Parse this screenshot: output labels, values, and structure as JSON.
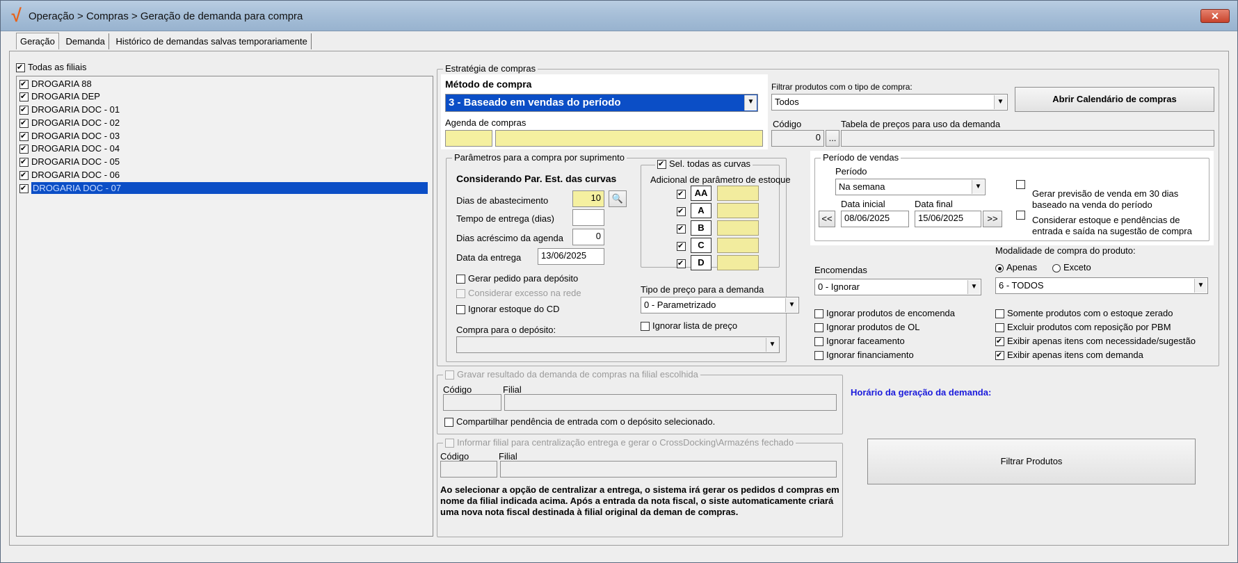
{
  "window": {
    "title": "Operação > Compras > Geração de demanda para compra",
    "close_icon": "close-icon"
  },
  "tabs": [
    "Geração",
    "Demanda",
    "Histórico de demandas salvas temporariamente"
  ],
  "branches": {
    "all_label": "Todas as filiais",
    "items": [
      "DROGARIA 88",
      "DROGARIA DEP",
      "DROGARIA DOC - 01",
      "DROGARIA DOC - 02",
      "DROGARIA DOC - 03",
      "DROGARIA DOC - 04",
      "DROGARIA DOC - 05",
      "DROGARIA DOC - 06",
      "DROGARIA DOC - 07"
    ]
  },
  "strategy": {
    "legend": "Estratégia de compras",
    "method_label": "Método de compra",
    "method_value": "3 - Baseado em vendas do período",
    "agenda_label": "Agenda de compras",
    "filter_type_label": "Filtrar produtos com o tipo de compra:",
    "filter_type_value": "Todos",
    "calendar_button": "Abrir Calendário de compras",
    "code_label": "Código",
    "code_value": "0",
    "code_btn": "...",
    "price_table_label": "Tabela de preços para uso da demanda"
  },
  "params": {
    "legend": "Parâmetros para a compra por suprimento",
    "heading": "Considerando Par. Est. das curvas",
    "supply_days_label": "Dias de abastecimento",
    "supply_days_value": "10",
    "delivery_time_label": "Tempo de entrega (dias)",
    "agenda_days_label": "Dias acréscimo da agenda",
    "agenda_days_value": "0",
    "delivery_date_label": "Data da entrega",
    "delivery_date_value": "13/06/2025",
    "gen_order_label": "Gerar pedido para depósito",
    "excess_label": "Considerar excesso na rede",
    "ignore_cd_label": "Ignorar estoque do CD",
    "deposit_label": "Compra para o depósito:",
    "curves_legend": "Sel. todas as curvas",
    "curves_sub": "Adicional de parâmetro de estoque",
    "curves": [
      "AA",
      "A",
      "B",
      "C",
      "D"
    ],
    "price_type_label": "Tipo de preço para a demanda",
    "price_type_value": "0 - Parametrizado",
    "ignore_price_list_label": "Ignorar lista de preço"
  },
  "sales_period": {
    "legend": "Período de vendas",
    "period_label": "Período",
    "period_value": "Na semana",
    "start_label": "Data inicial",
    "start_value": "08/06/2025",
    "end_label": "Data final",
    "end_value": "15/06/2025",
    "prev_btn": "<<",
    "next_btn": ">>",
    "forecast_label": "Gerar previsão de venda em 30 dias baseado na venda do período",
    "stock_pending_label": "Considerar estoque e pendências de entrada e saída  na sugestão de compra"
  },
  "orders": {
    "label": "Encomendas",
    "value": "0 - Ignorar",
    "modality_label": "Modalidade de compra do produto:",
    "only_label": "Apenas",
    "except_label": "Exceto",
    "modality_value": "6 - TODOS",
    "checks_left": [
      "Ignorar produtos de encomenda",
      "Ignorar produtos de OL",
      "Ignorar faceamento",
      "Ignorar financiamento"
    ],
    "checks_right": [
      "Somente produtos com o estoque zerado",
      "Excluir produtos com reposição por PBM",
      "Exibir apenas itens com necessidade/sugestão",
      "Exibir apenas itens com demanda"
    ]
  },
  "save_result": {
    "legend": "Gravar resultado da demanda de compras na filial escolhida",
    "code_label": "Código",
    "branch_label": "Filial",
    "share_label": "Compartilhar pendência de entrada com o depósito selecionado."
  },
  "centralize": {
    "legend": "Informar filial para centralização entrega e gerar o CrossDocking\\Armazéns fechado",
    "code_label": "Código",
    "branch_label": "Filial",
    "note": "Ao selecionar a opção de centralizar a entrega, o sistema irá gerar os pedidos d compras em nome da filial indicada acima. Após a entrada da nota fiscal, o siste automaticamente criará uma nova nota fiscal destinada à filial original da deman de compras."
  },
  "generation_time_label": "Horário da geração da demanda:",
  "filter_button": "Filtrar Produtos",
  "colors": {
    "accent": "#0b4ec6",
    "highlight_blue": "#1a1adb",
    "yellow_input": "#f5f0a0"
  }
}
